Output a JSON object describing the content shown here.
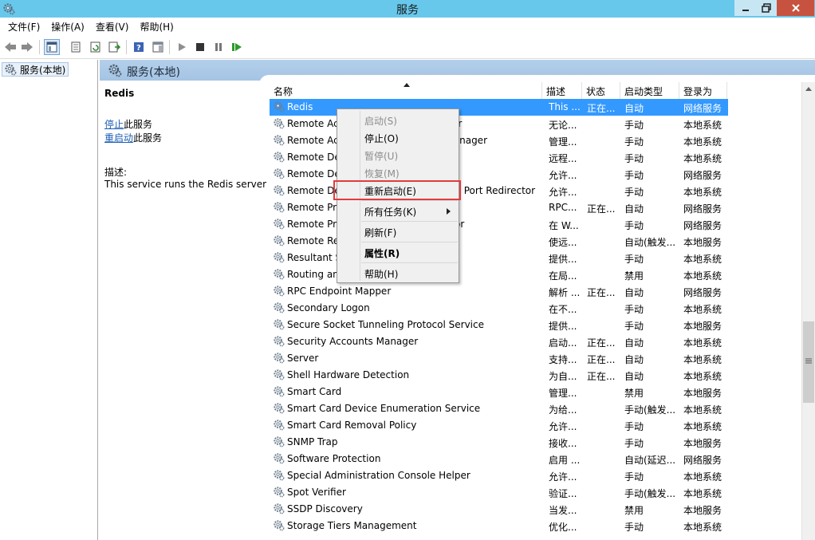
{
  "window": {
    "title": "服务"
  },
  "menu": [
    "文件(F)",
    "操作(A)",
    "查看(V)",
    "帮助(H)"
  ],
  "tree": {
    "root_label": "服务(本地)"
  },
  "header": {
    "title": "服务(本地)"
  },
  "detail": {
    "service_name": "Redis",
    "stop_link": "停止",
    "stop_suffix": "此服务",
    "restart_link": "重启动",
    "restart_suffix": "此服务",
    "desc_label": "描述:",
    "desc_text": "This service runs the Redis server"
  },
  "columns": [
    "名称",
    "描述",
    "状态",
    "启动类型",
    "登录为"
  ],
  "rows": [
    {
      "name": "Redis",
      "desc": "This ...",
      "status": "正在...",
      "startup": "自动",
      "logon": "网络服务",
      "selected": true
    },
    {
      "name": "Remote Access Connection Manager",
      "desc": "无论...",
      "status": "",
      "startup": "手动",
      "logon": "本地系统"
    },
    {
      "name": "Remote Access Auto Connection Manager",
      "desc": "管理...",
      "status": "",
      "startup": "手动",
      "logon": "本地系统"
    },
    {
      "name": "Remote Desktop Configuration",
      "desc": "远程...",
      "status": "",
      "startup": "手动",
      "logon": "本地系统"
    },
    {
      "name": "Remote Desktop Services",
      "desc": "允许...",
      "status": "",
      "startup": "手动",
      "logon": "网络服务"
    },
    {
      "name": "Remote Desktop Services UserMode Port Redirector",
      "desc": "允许...",
      "status": "",
      "startup": "手动",
      "logon": "本地系统"
    },
    {
      "name": "Remote Procedure Call (RPC)",
      "desc": "RPC...",
      "status": "正在...",
      "startup": "自动",
      "logon": "网络服务"
    },
    {
      "name": "Remote Procedure Call (RPC) Locator",
      "desc": "在 W...",
      "status": "",
      "startup": "手动",
      "logon": "网络服务"
    },
    {
      "name": "Remote Registry",
      "desc": "使远...",
      "status": "",
      "startup": "自动(触发...",
      "logon": "本地服务"
    },
    {
      "name": "Resultant Set of Policy Provider",
      "desc": "提供...",
      "status": "",
      "startup": "手动",
      "logon": "本地系统"
    },
    {
      "name": "Routing and Remote Access",
      "desc": "在局...",
      "status": "",
      "startup": "禁用",
      "logon": "本地系统"
    },
    {
      "name": "RPC Endpoint Mapper",
      "desc": "解析 ...",
      "status": "正在...",
      "startup": "自动",
      "logon": "网络服务"
    },
    {
      "name": "Secondary Logon",
      "desc": "在不...",
      "status": "",
      "startup": "手动",
      "logon": "本地系统"
    },
    {
      "name": "Secure Socket Tunneling Protocol Service",
      "desc": "提供...",
      "status": "",
      "startup": "手动",
      "logon": "本地服务"
    },
    {
      "name": "Security Accounts Manager",
      "desc": "启动...",
      "status": "正在...",
      "startup": "自动",
      "logon": "本地系统"
    },
    {
      "name": "Server",
      "desc": "支持...",
      "status": "正在...",
      "startup": "自动",
      "logon": "本地系统"
    },
    {
      "name": "Shell Hardware Detection",
      "desc": "为自...",
      "status": "正在...",
      "startup": "自动",
      "logon": "本地系统"
    },
    {
      "name": "Smart Card",
      "desc": "管理...",
      "status": "",
      "startup": "禁用",
      "logon": "本地服务"
    },
    {
      "name": "Smart Card Device Enumeration Service",
      "desc": "为给...",
      "status": "",
      "startup": "手动(触发...",
      "logon": "本地系统"
    },
    {
      "name": "Smart Card Removal Policy",
      "desc": "允许...",
      "status": "",
      "startup": "手动",
      "logon": "本地系统"
    },
    {
      "name": "SNMP Trap",
      "desc": "接收...",
      "status": "",
      "startup": "手动",
      "logon": "本地服务"
    },
    {
      "name": "Software Protection",
      "desc": "启用 ...",
      "status": "",
      "startup": "自动(延迟...",
      "logon": "网络服务"
    },
    {
      "name": "Special Administration Console Helper",
      "desc": "允许...",
      "status": "",
      "startup": "手动",
      "logon": "本地系统"
    },
    {
      "name": "Spot Verifier",
      "desc": "验证...",
      "status": "",
      "startup": "手动(触发...",
      "logon": "本地系统"
    },
    {
      "name": "SSDP Discovery",
      "desc": "当发...",
      "status": "",
      "startup": "禁用",
      "logon": "本地服务"
    },
    {
      "name": "Storage Tiers Management",
      "desc": "优化...",
      "status": "",
      "startup": "手动",
      "logon": "本地系统"
    }
  ],
  "context_menu": {
    "start": "启动(S)",
    "stop": "停止(O)",
    "pause": "暂停(U)",
    "resume": "恢复(M)",
    "restart": "重新启动(E)",
    "all_tasks": "所有任务(K)",
    "refresh": "刷新(F)",
    "properties": "属性(R)",
    "help": "帮助(H)"
  },
  "colors": {
    "titlebar": "#67c8ec",
    "selection": "#3399ff",
    "highlight_box": "#e23c3c",
    "close_button": "#c7523f"
  }
}
